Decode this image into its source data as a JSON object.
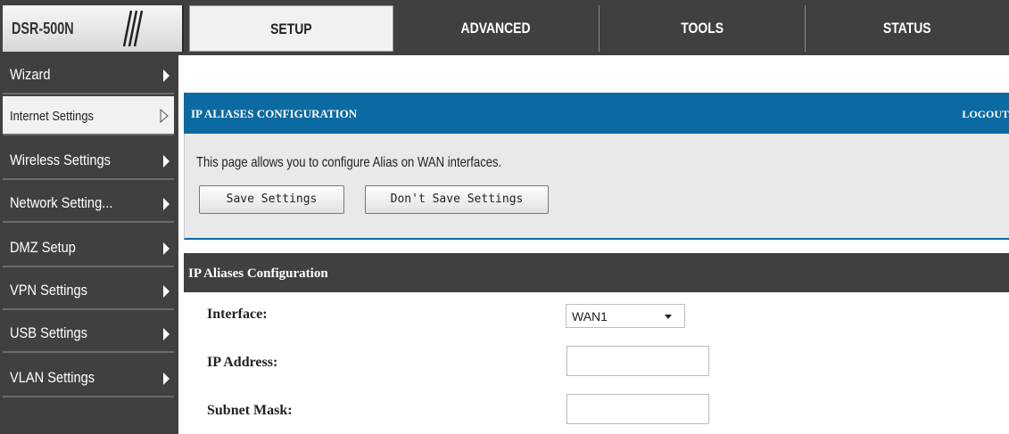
{
  "logo": {
    "text": "DSR-500N"
  },
  "tabs": [
    {
      "label": "SETUP",
      "active": true
    },
    {
      "label": "ADVANCED",
      "active": false
    },
    {
      "label": "TOOLS",
      "active": false
    },
    {
      "label": "STATUS",
      "active": false
    }
  ],
  "sidebar": {
    "items": [
      {
        "label": "Wizard",
        "active": false
      },
      {
        "label": "Internet Settings",
        "active": true
      },
      {
        "label": "Wireless Settings",
        "active": false
      },
      {
        "label": "Network Setting...",
        "active": false
      },
      {
        "label": "DMZ Setup",
        "active": false
      },
      {
        "label": "VPN Settings",
        "active": false
      },
      {
        "label": "USB Settings",
        "active": false
      },
      {
        "label": "VLAN Settings",
        "active": false
      }
    ]
  },
  "panel": {
    "title": "IP ALIASES CONFIGURATION",
    "logout": "LOGOUT",
    "description": "This page allows you to configure Alias on WAN interfaces.",
    "save_label": "Save Settings",
    "dont_save_label": "Don't Save Settings"
  },
  "section": {
    "title": "IP Aliases Configuration",
    "interface_label": "Interface:",
    "interface_value": "WAN1",
    "ip_label": "IP Address:",
    "ip_value": "",
    "subnet_label": "Subnet Mask:",
    "subnet_value": ""
  },
  "colors": {
    "header_bar": "#404040",
    "panel_blue": "#0a6aa1",
    "panel_body": "#e9e9e9"
  }
}
